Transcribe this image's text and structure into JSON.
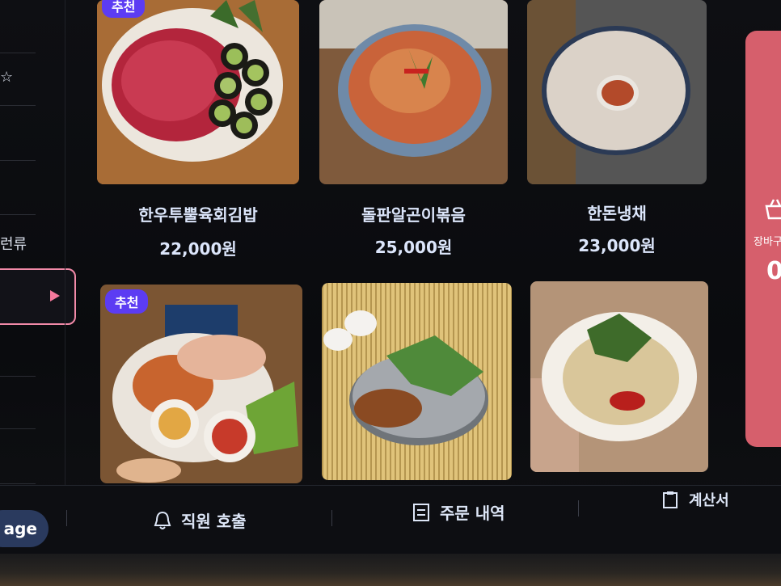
{
  "sidebar": {
    "items": [
      {
        "label": "☆",
        "icon": "star-icon"
      },
      {
        "label": "런류"
      },
      {
        "label": ""
      }
    ]
  },
  "menu_items": [
    {
      "name": "한우투뿔육회김밥",
      "price": "22,000원",
      "badge": "추천"
    },
    {
      "name": "돌판알곤이볶음",
      "price": "25,000원",
      "badge": ""
    },
    {
      "name": "한돈냉채",
      "price": "23,000원",
      "badge": ""
    },
    {
      "name": "",
      "price": "",
      "badge": "추천"
    },
    {
      "name": "",
      "price": "",
      "badge": ""
    },
    {
      "name": "",
      "price": "",
      "badge": ""
    }
  ],
  "cart": {
    "label": "장바구",
    "count": "0",
    "icon": "basket-icon"
  },
  "bottom": {
    "language": "age",
    "call_staff": "직원 호출",
    "order_history": "주문 내역",
    "bill": "계산서"
  }
}
